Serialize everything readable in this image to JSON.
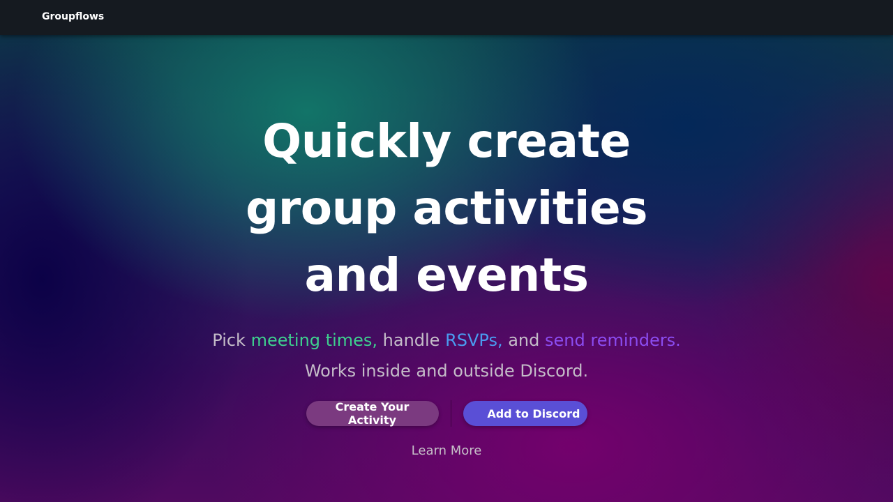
{
  "nav": {
    "brand": "Groupflows"
  },
  "hero": {
    "headline": [
      "Quickly create",
      "group activities",
      "and events"
    ],
    "sub_line1": {
      "pick": "Pick ",
      "meeting_times": "meeting times,",
      "handle": " handle ",
      "rsvps": "RSVPs,",
      "and": " and ",
      "send_reminders": "send reminders."
    },
    "sub_line2": "Works inside and outside Discord.",
    "create_button": "Create Your Activity",
    "discord_button": "Add to Discord",
    "learn_more": "Learn More"
  },
  "colors": {
    "navbar": "#151a20",
    "green_highlight": "#3ecf8e",
    "blue_highlight": "#4a9cf0",
    "purple_highlight": "#8b4cf0",
    "create_button": "#7b3a80",
    "discord_button": "#5a4fd6"
  }
}
